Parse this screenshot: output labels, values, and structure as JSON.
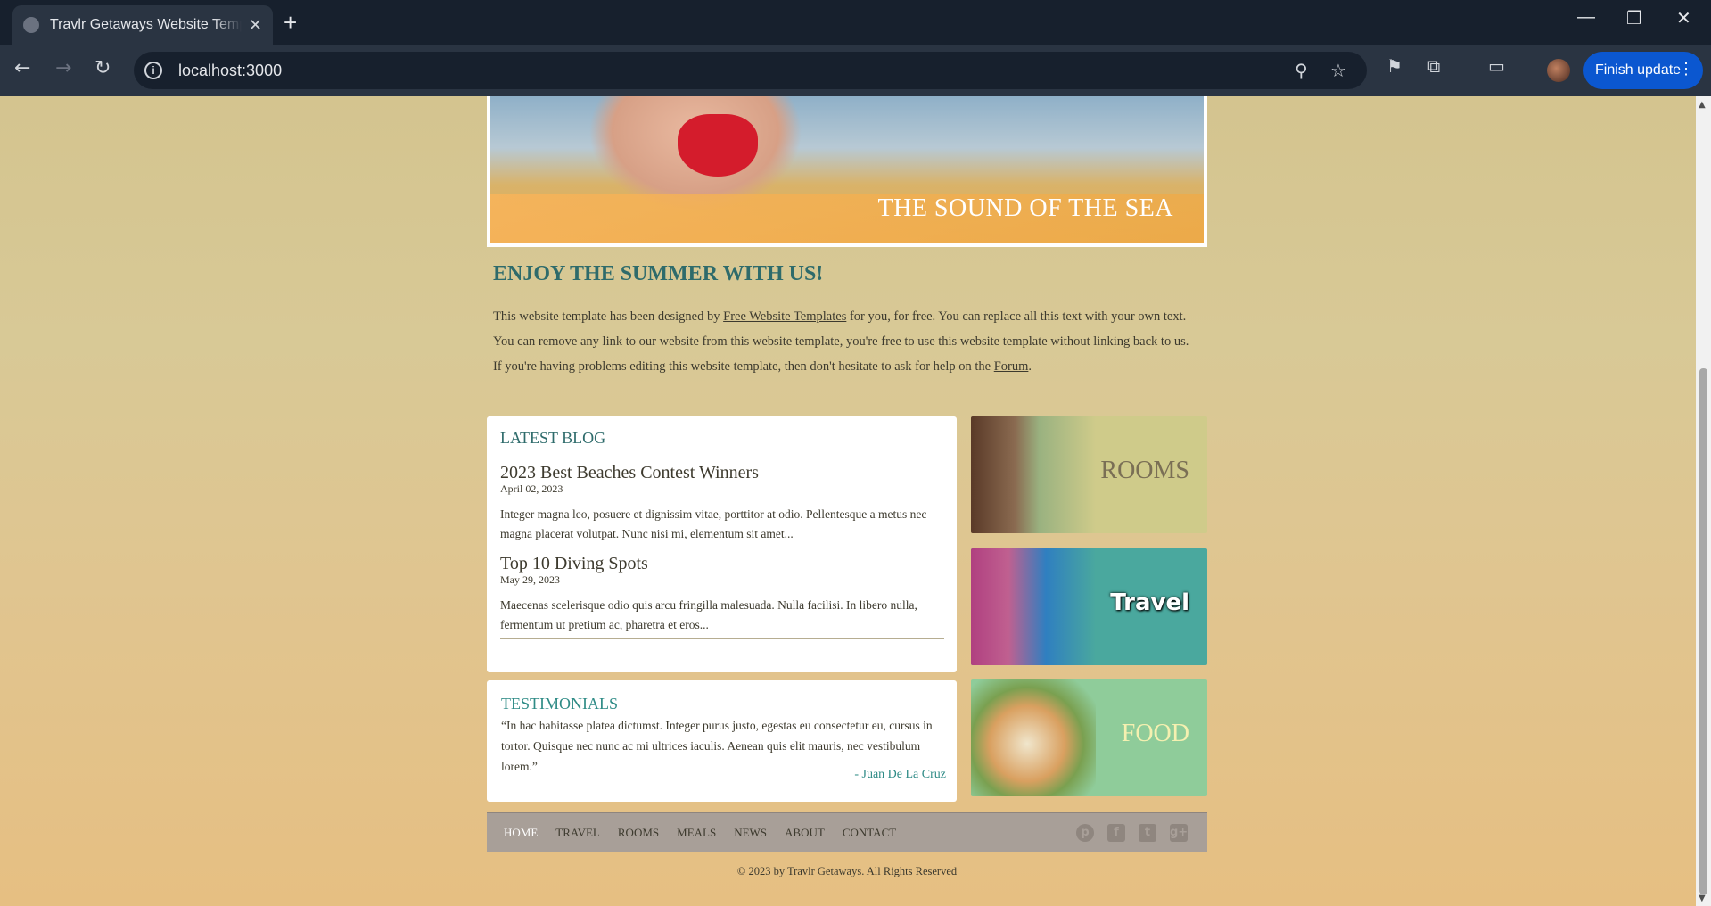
{
  "browser": {
    "tab_title": "Travlr Getaways Website Template",
    "tab_close": "✕",
    "new_tab": "+",
    "url": "localhost:3000",
    "finish_update": "Finish update",
    "window_controls": [
      "—",
      "❐",
      "✕"
    ],
    "nav_icons": [
      "back-icon",
      "forward-icon",
      "reload-icon"
    ]
  },
  "hero": {
    "caption": "THE SOUND OF THE SEA"
  },
  "intro": {
    "title": "ENJOY THE SUMMER WITH US!",
    "text_1": "This website template has been designed by ",
    "link_1": "Free Website Templates",
    "text_2": " for you, for free. You can replace all this text with your own text. You can remove any link to our website from this website template, you're free to use this website template without linking back to us. If you're having problems editing this website template, then don't hesitate to ask for help on the ",
    "link_2": "Forum",
    "text_3": "."
  },
  "blog": {
    "title": "LATEST BLOG",
    "posts": [
      {
        "title": "2023 Best Beaches Contest Winners",
        "date": "April 02, 2023",
        "excerpt": "Integer magna leo, posuere et dignissim vitae, porttitor at odio. Pellentesque a metus nec magna placerat volutpat. Nunc nisi mi, elementum sit amet..."
      },
      {
        "title": "Top 10 Diving Spots",
        "date": "May 29, 2023",
        "excerpt": "Maecenas scelerisque odio quis arcu fringilla malesuada. Nulla facilisi. In libero nulla, fermentum ut pretium ac, pharetra et eros..."
      }
    ]
  },
  "testimonials": {
    "title": "TESTIMONIALS",
    "quote": "“In hac habitasse platea dictumst. Integer purus justo, egestas eu consectetur eu, cursus in tortor. Quisque nec nunc ac mi ultrices iaculis. Aenean quis elit mauris, nec vestibulum lorem.”",
    "author": "- Juan De La Cruz"
  },
  "tiles": {
    "rooms": "ROOMS",
    "travel": "Travel",
    "food": "FOOD"
  },
  "footer": {
    "nav": [
      "HOME",
      "TRAVEL",
      "ROOMS",
      "MEALS",
      "NEWS",
      "ABOUT",
      "CONTACT"
    ],
    "social": [
      "pinterest-icon",
      "facebook-icon",
      "twitter-icon",
      "google-plus-icon"
    ],
    "copyright": "© 2023 by Travlr Getaways. All Rights Reserved"
  },
  "colors": {
    "accent_teal": "#2e6b6b",
    "finish_button": "#0b57d0",
    "footer_bar": "#a89f98"
  }
}
